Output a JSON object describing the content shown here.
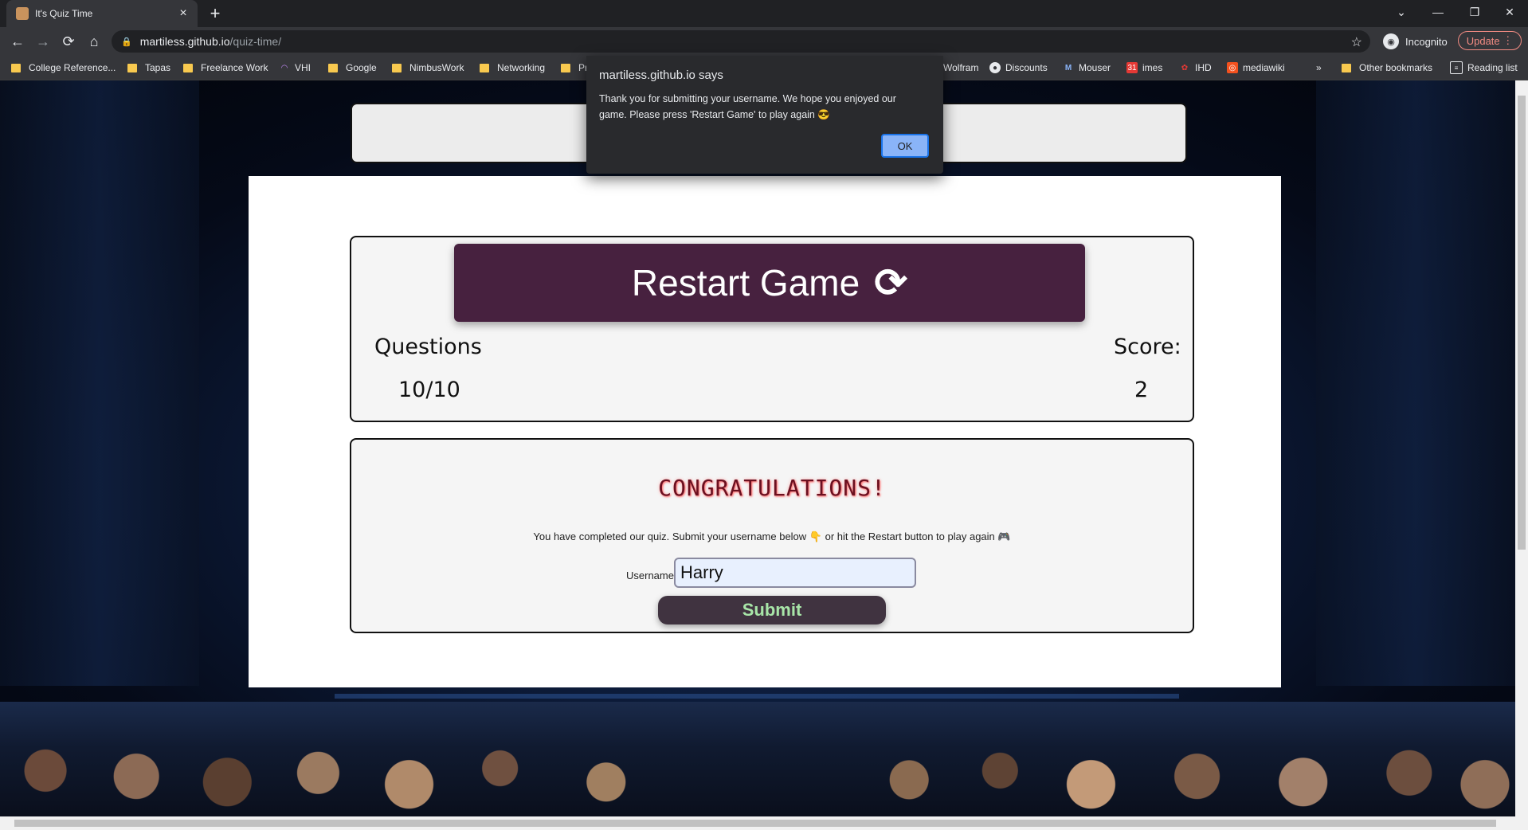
{
  "browser": {
    "tab_title": "It's Quiz Time",
    "url_host": "martiless.github.io",
    "url_path": "/quiz-time/",
    "profile_label": "Incognito",
    "update_label": "Update",
    "bookmarks": [
      "College Reference...",
      "Tapas",
      "Freelance Work",
      "VHI",
      "Google",
      "NimbusWork",
      "Networking",
      "Pr",
      "Wolfram",
      "Discounts",
      "Mouser",
      "imes",
      "IHD",
      "mediawiki"
    ],
    "overflow_label": "»",
    "other_bookmarks": "Other bookmarks",
    "reading_list": "Reading list"
  },
  "dialog": {
    "title": "martiless.github.io says",
    "message": "Thank you for submitting your username. We hope you enjoyed our game. Please press 'Restart Game' to play again 😎",
    "ok_label": "OK"
  },
  "quiz": {
    "restart_label": "Restart Game",
    "restart_icon": "⟳",
    "questions_label": "Questions",
    "questions_value": "10/10",
    "score_label": "Score:",
    "score_value": "2",
    "congrats_title": "CONGRATULATIONS!",
    "completed_message": "You have completed our quiz. Submit your username below 👇 or hit the Restart button to play again 🎮",
    "username_label": "Username",
    "username_value": "Harry",
    "submit_label": "Submit"
  }
}
